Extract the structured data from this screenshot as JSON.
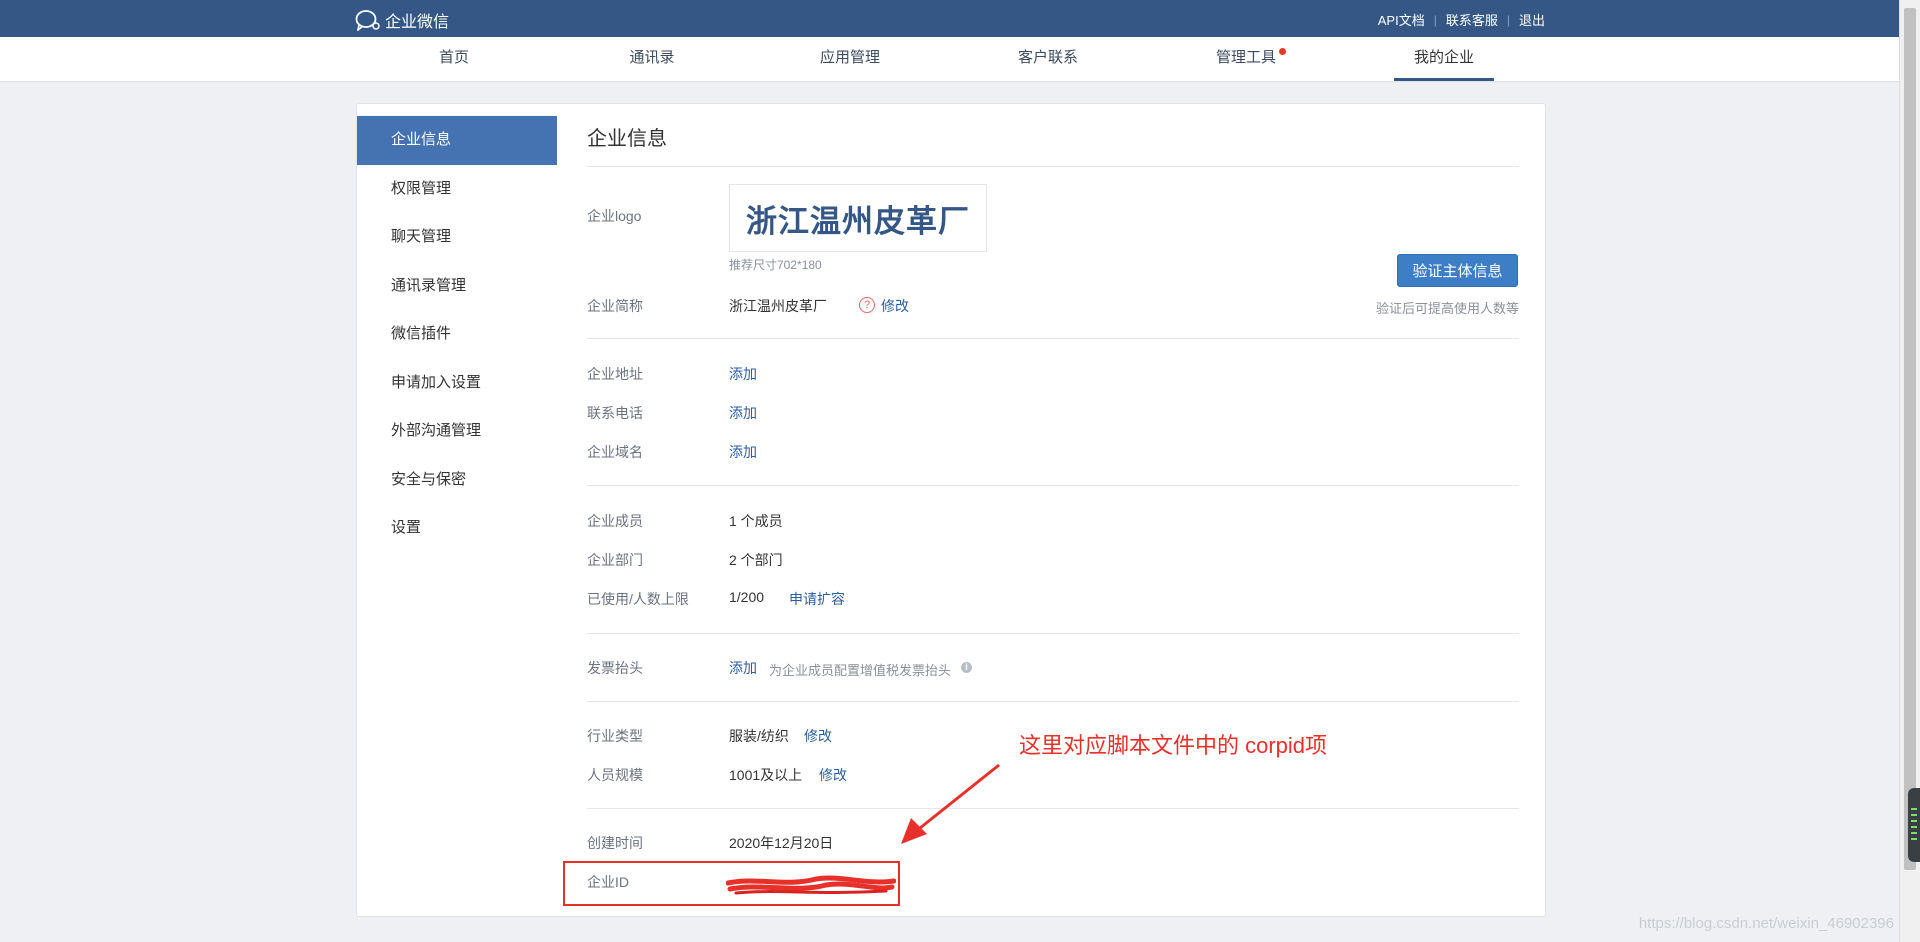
{
  "topbar": {
    "app_name": "企业微信",
    "links": [
      "API文档",
      "联系客服",
      "退出"
    ]
  },
  "nav": {
    "tabs": [
      "首页",
      "通讯录",
      "应用管理",
      "客户联系",
      "管理工具",
      "我的企业"
    ],
    "active": "我的企业"
  },
  "sidebar": {
    "items": [
      "企业信息",
      "权限管理",
      "聊天管理",
      "通讯录管理",
      "微信插件",
      "申请加入设置",
      "外部沟通管理",
      "安全与保密",
      "设置"
    ]
  },
  "main": {
    "title": "企业信息",
    "logo_label": "企业logo",
    "logo_text": "浙江温州皮革厂",
    "logo_hint": "推荐尺寸702*180",
    "verify_button": "验证主体信息",
    "verify_hint": "验证后可提高使用人数等",
    "short_name_label": "企业简称",
    "short_name": "浙江温州皮革厂",
    "modify": "修改",
    "address_label": "企业地址",
    "phone_label": "联系电话",
    "domain_label": "企业域名",
    "add": "添加",
    "members_label": "企业成员",
    "members": "1 个成员",
    "departments_label": "企业部门",
    "departments": "2 个部门",
    "usage_label": "已使用/人数上限",
    "usage": "1/200",
    "expand": "申请扩容",
    "invoice_label": "发票抬头",
    "invoice_hint": "为企业成员配置增值税发票抬头",
    "industry_label": "行业类型",
    "industry": "服装/纺织",
    "scale_label": "人员规模",
    "scale": "1001及以上",
    "created_label": "创建时间",
    "created": "2020年12月20日",
    "corpid_label": "企业ID"
  },
  "annotation": {
    "text": "这里对应脚本文件中的 corpid项",
    "color": "#e8302b"
  },
  "watermark": "https://blog.csdn.net/weixin_46902396",
  "colors": {
    "topbar": "#355786",
    "accent": "#4573b2",
    "link": "#2b5e9f",
    "annotation": "#e8302b"
  }
}
